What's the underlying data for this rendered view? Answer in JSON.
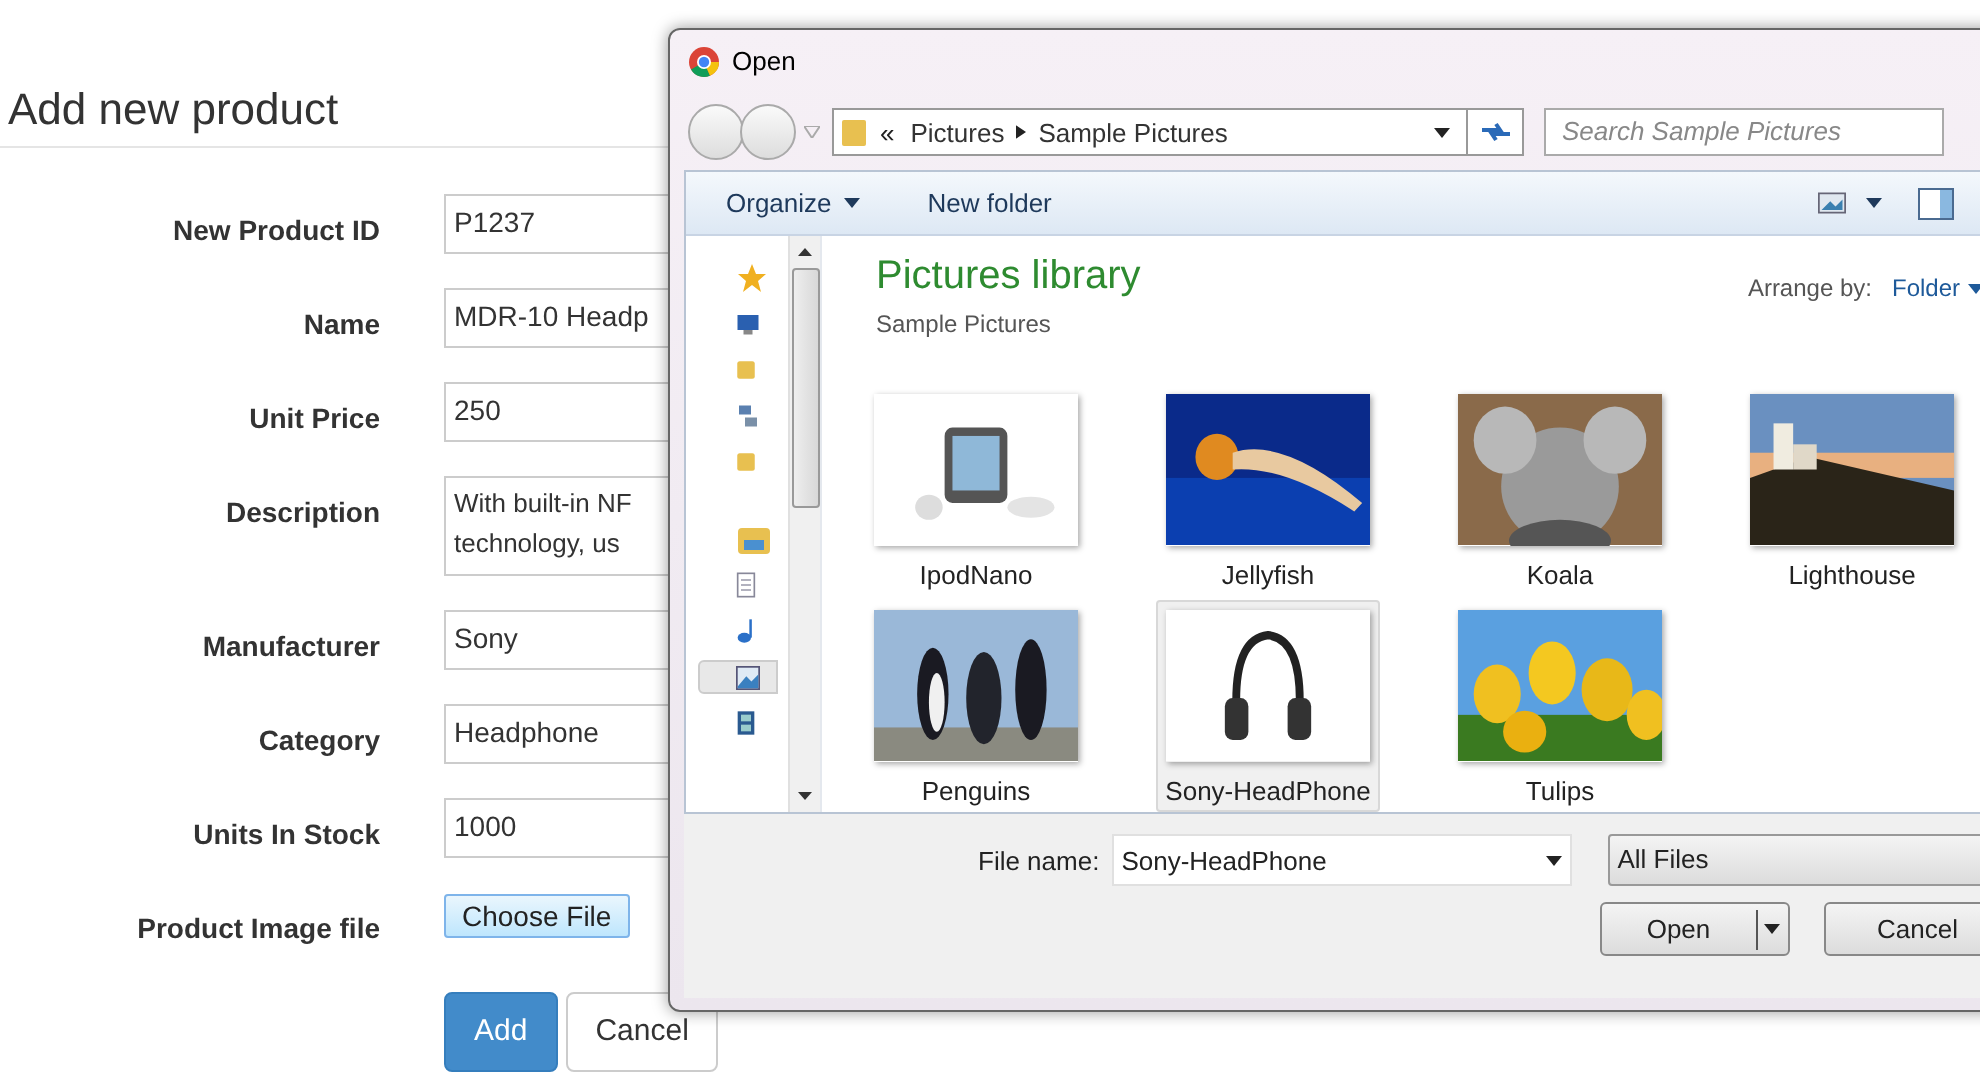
{
  "page": {
    "title": "Add new product"
  },
  "form": {
    "fields": [
      {
        "label": "New Product ID",
        "kind": "input",
        "lines": [
          "P1237"
        ]
      },
      {
        "label": "Name",
        "kind": "input",
        "lines": [
          "MDR-10 Headp"
        ]
      },
      {
        "label": "Unit Price",
        "kind": "input",
        "lines": [
          "250"
        ]
      },
      {
        "label": "Description",
        "kind": "textarea",
        "lines": [
          "With built-in NF",
          "technology, us"
        ]
      },
      {
        "label": "Manufacturer",
        "kind": "input",
        "lines": [
          "Sony"
        ]
      },
      {
        "label": "Category",
        "kind": "input",
        "lines": [
          "Headphone"
        ]
      },
      {
        "label": "Units In Stock",
        "kind": "input",
        "lines": [
          "1000"
        ]
      },
      {
        "label": "Product Image file",
        "kind": "file",
        "button": "Choose File"
      }
    ],
    "buttons": [
      {
        "label": "Add",
        "kind": "primary"
      },
      {
        "label": "Cancel",
        "kind": "default"
      }
    ]
  },
  "dialog": {
    "title": "Open",
    "breadcrumb": {
      "prefix": "«",
      "parts": [
        "Pictures",
        "Sample Pictures"
      ]
    },
    "search": {
      "placeholder": "Search Sample Pictures"
    },
    "toolbar": [
      {
        "label": "Organize",
        "menu": true
      },
      {
        "label": "New folder",
        "menu": false
      }
    ],
    "nav_items": [
      {
        "kind": "star",
        "selected": false
      },
      {
        "kind": "desktop",
        "selected": false
      },
      {
        "kind": "folder",
        "selected": false
      },
      {
        "kind": "network",
        "selected": false
      },
      {
        "kind": "folder",
        "selected": false
      },
      {
        "kind": "library",
        "selected": false
      },
      {
        "kind": "document",
        "selected": false
      },
      {
        "kind": "music",
        "selected": false
      },
      {
        "kind": "pictures",
        "selected": true
      },
      {
        "kind": "video",
        "selected": false
      }
    ],
    "library": {
      "title": "Pictures library",
      "subtitle": "Sample Pictures",
      "arrange_label": "Arrange by:",
      "arrange_value": "Folder"
    },
    "files": [
      {
        "name": "IpodNano",
        "selected": false
      },
      {
        "name": "Jellyfish",
        "selected": false
      },
      {
        "name": "Koala",
        "selected": false
      },
      {
        "name": "Lighthouse",
        "selected": false
      },
      {
        "name": "Penguins",
        "selected": false
      },
      {
        "name": "Sony-HeadPhone",
        "selected": true
      },
      {
        "name": "Tulips",
        "selected": false
      }
    ],
    "file_name": {
      "label": "File name:",
      "value": "Sony-HeadPhone"
    },
    "file_type": "All Files",
    "buttons": [
      {
        "label": "Open",
        "kind": "split"
      },
      {
        "label": "Cancel",
        "kind": "plain"
      }
    ]
  }
}
